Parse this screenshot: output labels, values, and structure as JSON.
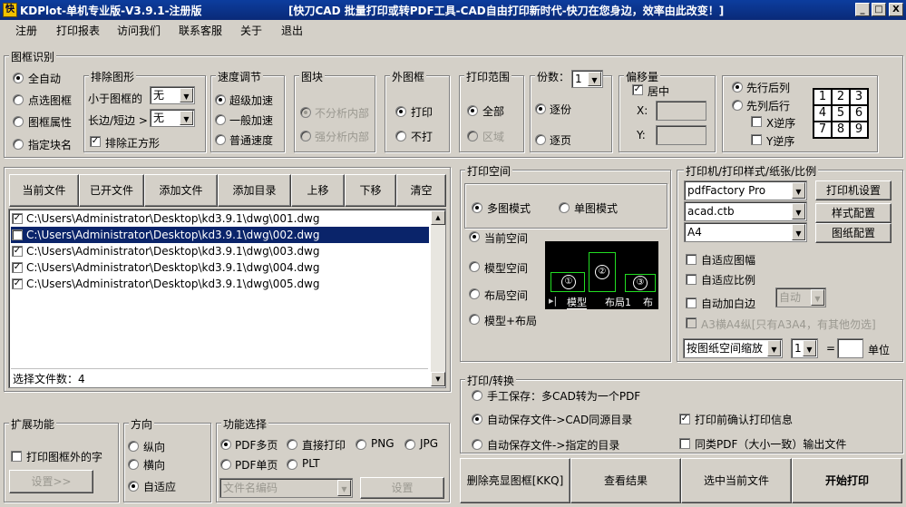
{
  "titlebar": {
    "title": "KDPlot-单机专业版-V3.9.1-注册版",
    "slogan": "[快刀CAD 批量打印或转PDF工具-CAD自由打印新时代-快刀在您身边，效率由此改变！]",
    "app_icon": "快",
    "minimize": "_",
    "maximize": "□",
    "close": "X"
  },
  "menu": [
    "注册",
    "打印报表",
    "访问我们",
    "联系客服",
    "关于",
    "退出"
  ],
  "frame_recognition": {
    "title": "图框识别",
    "modes": [
      {
        "label": "全自动",
        "checked": true
      },
      {
        "label": "点选图框",
        "checked": false
      },
      {
        "label": "图框属性",
        "checked": false
      },
      {
        "label": "指定块名",
        "checked": false
      }
    ],
    "exclude": {
      "title": "排除图形",
      "less_than_label": "小于图框的",
      "less_than_value": "无",
      "ratio_label": "长边/短边 >",
      "ratio_value": "无",
      "square_label": "排除正方形",
      "square_checked": true
    },
    "speed": {
      "title": "速度调节",
      "options": [
        {
          "label": "超级加速",
          "checked": true
        },
        {
          "label": "一般加速",
          "checked": false
        },
        {
          "label": "普通速度",
          "checked": false
        }
      ]
    },
    "block": {
      "title": "图块",
      "options": [
        {
          "label": "不分析内部",
          "checked": true
        },
        {
          "label": "强分析内部",
          "checked": false
        }
      ]
    },
    "outer": {
      "title": "外图框",
      "options": [
        {
          "label": "打印",
          "checked": true
        },
        {
          "label": "不打",
          "checked": false
        }
      ]
    },
    "range": {
      "title": "打印范围",
      "options": [
        {
          "label": "全部",
          "checked": true
        },
        {
          "label": "区域",
          "checked": false
        }
      ]
    },
    "copies": {
      "title": "份数：",
      "value": "1",
      "options": [
        {
          "label": "逐份",
          "checked": true
        },
        {
          "label": "逐页",
          "checked": false
        }
      ]
    },
    "offset": {
      "title": "偏移量",
      "center_label": "居中",
      "center_checked": true,
      "x_label": "X:",
      "y_label": "Y:"
    },
    "order": {
      "options": [
        {
          "label": "先行后列",
          "checked": true
        },
        {
          "label": "先列后行",
          "checked": false
        }
      ],
      "x_reverse": "X逆序",
      "y_reverse": "Y逆序",
      "grid": [
        "1",
        "2",
        "3",
        "4",
        "5",
        "6",
        "7",
        "8",
        "9"
      ]
    }
  },
  "files": {
    "buttons": [
      "当前文件",
      "已开文件",
      "添加文件",
      "添加目录",
      "上移",
      "下移",
      "清空"
    ],
    "items": [
      {
        "path": "C:\\Users\\Administrator\\Desktop\\kd3.9.1\\dwg\\001.dwg",
        "checked": true,
        "selected": false
      },
      {
        "path": "C:\\Users\\Administrator\\Desktop\\kd3.9.1\\dwg\\002.dwg",
        "checked": false,
        "selected": true
      },
      {
        "path": "C:\\Users\\Administrator\\Desktop\\kd3.9.1\\dwg\\003.dwg",
        "checked": true,
        "selected": false
      },
      {
        "path": "C:\\Users\\Administrator\\Desktop\\kd3.9.1\\dwg\\004.dwg",
        "checked": true,
        "selected": false
      },
      {
        "path": "C:\\Users\\Administrator\\Desktop\\kd3.9.1\\dwg\\005.dwg",
        "checked": true,
        "selected": false
      }
    ],
    "status": "选择文件数：4"
  },
  "print_space": {
    "title": "打印空间",
    "modes": [
      {
        "label": "多图模式",
        "checked": true
      },
      {
        "label": "单图模式",
        "checked": false
      }
    ],
    "spaces": [
      {
        "label": "当前空间",
        "checked": true
      },
      {
        "label": "模型空间",
        "checked": false
      },
      {
        "label": "布局空间",
        "checked": false
      },
      {
        "label": "模型+布局",
        "checked": false
      }
    ],
    "preview_nums": [
      "①",
      "②",
      "③"
    ],
    "preview_tabs": [
      "模型",
      "布局1",
      "布"
    ]
  },
  "printer": {
    "title": "打印机/打印样式/纸张/比例",
    "printer_value": "pdfFactory Pro",
    "printer_button": "打印机设置",
    "style_value": "acad.ctb",
    "style_button": "样式配置",
    "paper_value": "A4",
    "paper_button": "图纸配置",
    "fit_sheet": "自适应图幅",
    "fit_scale": "自适应比例",
    "auto_margin": "自动加白边",
    "auto_value": "自动",
    "a3_rule": "A3横A4纵[只有A3A4，有其他勿选]",
    "scale_mode": "按图纸空间缩放",
    "scale_value": "1",
    "equals": "=",
    "unit": "单位"
  },
  "extension": {
    "title": "扩展功能",
    "print_outside": "打印图框外的字",
    "settings_button": "设置>>"
  },
  "direction": {
    "title": "方向",
    "options": [
      {
        "label": "纵向",
        "checked": false
      },
      {
        "label": "横向",
        "checked": false
      },
      {
        "label": "自适应",
        "checked": true
      }
    ]
  },
  "function": {
    "title": "功能选择",
    "options": [
      {
        "label": "PDF多页",
        "checked": true
      },
      {
        "label": "直接打印",
        "checked": false
      },
      {
        "label": "PNG",
        "checked": false
      },
      {
        "label": "JPG",
        "checked": false
      },
      {
        "label": "PDF单页",
        "checked": false
      },
      {
        "label": "PLT",
        "checked": false
      }
    ],
    "encoding_value": "文件名编码",
    "settings_button": "设置"
  },
  "convert": {
    "title": "打印/转换",
    "options": [
      {
        "label": "手工保存：多CAD转为一个PDF",
        "checked": false
      },
      {
        "label": "自动保存文件->CAD同源目录",
        "checked": true
      },
      {
        "label": "自动保存文件->指定的目录",
        "checked": false
      }
    ],
    "confirm_info": "打印前确认打印信息",
    "same_pdf": "同类PDF（大小一致）输出文件"
  },
  "actions": {
    "delete_frames": "删除亮显图框[KKQ]",
    "view_results": "查看结果",
    "select_current": "选中当前文件",
    "start_print": "开始打印"
  }
}
